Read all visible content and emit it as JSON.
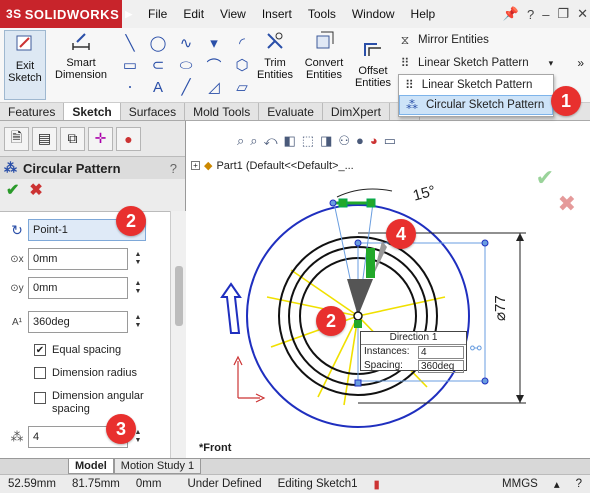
{
  "app": {
    "logo_text": "SOLIDWORKS",
    "logo_prefix": "3S"
  },
  "menubar": [
    "File",
    "Edit",
    "View",
    "Insert",
    "Tools",
    "Window",
    "Help"
  ],
  "command_manager": {
    "exit_sketch": "Exit Sketch",
    "smart_dimension": "Smart Dimension",
    "trim_entities": "Trim Entities",
    "convert_entities": "Convert Entities",
    "offset_entities": "Offset Entities",
    "mirror_entities": "Mirror Entities",
    "linear_sketch_pattern": "Linear Sketch Pattern"
  },
  "pattern_dropdown": {
    "items": [
      "Linear Sketch Pattern",
      "Circular Sketch Pattern"
    ],
    "selected": "Circular Sketch Pattern"
  },
  "tabs": [
    "Features",
    "Sketch",
    "Surfaces",
    "Mold Tools",
    "Evaluate",
    "DimXpert",
    "Of"
  ],
  "active_tab": "Sketch",
  "property_manager": {
    "title": "Circular Pattern",
    "help": "?",
    "center_point": "Point-1",
    "x_value": "0mm",
    "y_value": "0mm",
    "angle_value": "360deg",
    "equal_spacing_label": "Equal spacing",
    "equal_spacing_checked": true,
    "dimension_radius_label": "Dimension radius",
    "dimension_radius_checked": false,
    "dimension_angular_label": "Dimension angular spacing",
    "dimension_angular_checked": false,
    "instances_value": "4"
  },
  "graphics": {
    "tree_root": "Part1  (Default<<Default>_...",
    "view_name": "*Front",
    "angle_dim": "15°",
    "diameter_dim": "⌀77",
    "direction_box": {
      "title": "Direction 1",
      "instances_label": "Instances:",
      "instances_value": "4",
      "spacing_label": "Spacing:",
      "spacing_value": "360deg"
    }
  },
  "callouts": [
    "1",
    "2",
    "2",
    "3",
    "4"
  ],
  "bottom_tabs": [
    "Model",
    "Motion Study 1"
  ],
  "active_bottom_tab": "Model",
  "status_bar": {
    "x": "52.59mm",
    "y": "81.75mm",
    "z": "0mm",
    "state": "Under Defined",
    "editing": "Editing Sketch1",
    "units": "MMGS"
  },
  "colors": {
    "brand_red": "#c8242b",
    "callout_red": "#e8302e",
    "sketch_blue": "#1f2fbf",
    "pattern_yellow": "#f0e000",
    "selected_green": "#22a82a"
  }
}
